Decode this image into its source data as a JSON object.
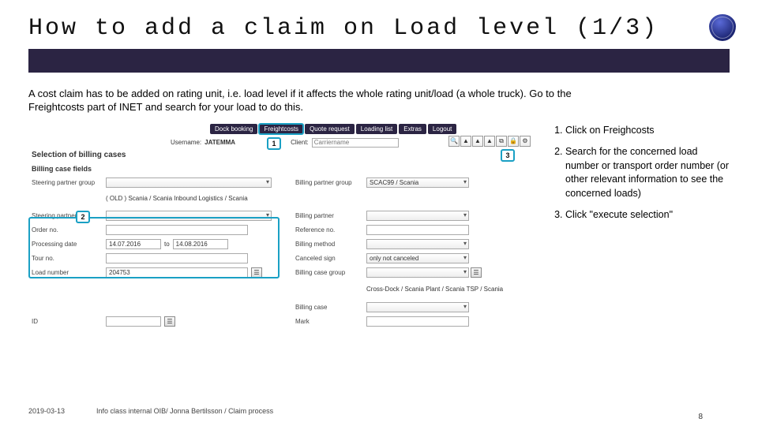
{
  "title": "How to add a claim on Load level (1/3)",
  "intro": "A cost claim has to be added on rating unit, i.e. load level if it affects the whole rating unit/load (a whole truck). Go to the Freightcosts part of INET and search for your load to do this.",
  "nav": {
    "tabs": [
      "Dock booking",
      "Freightcosts",
      "Quote request",
      "Loading list",
      "Extras",
      "Logout"
    ],
    "active_index": 1
  },
  "userline": {
    "username_label": "Username:",
    "username_value": "JATEMMA",
    "client_label": "Client:",
    "client_placeholder": "Carriername"
  },
  "sections": {
    "selection_title": "Selection of billing cases",
    "fields_title": "Billing case fields"
  },
  "form": {
    "steering_partner_group_label": "Steering partner group",
    "steering_partner_group_value": "( OLD ) Scania / Scania Inbound Logistics / Scania",
    "billing_partner_group_label": "Billing partner group",
    "billing_partner_group_value": "SCAC99 / Scania",
    "steering_partner_label": "Steering partner",
    "billing_partner_label": "Billing partner",
    "order_no_label": "Order no.",
    "reference_no_label": "Reference no.",
    "processing_date_label": "Processing date",
    "processing_date_from": "14.07.2016",
    "processing_date_to_label": "to",
    "processing_date_to": "14.08.2016",
    "billing_method_label": "Billing method",
    "tour_no_label": "Tour no.",
    "canceled_sign_label": "Canceled sign",
    "canceled_sign_value": "only not canceled",
    "load_number_label": "Load number",
    "load_number_value": "204753",
    "billing_case_group_label": "Billing case group",
    "billing_case_group_value": "Cross-Dock / Scania Plant / Scania TSP / Scania",
    "billing_case_label": "Billing case",
    "mark_label": "Mark",
    "id_label": "ID"
  },
  "callouts": {
    "c1": "1",
    "c2": "2",
    "c3": "3"
  },
  "instructions": {
    "i1": "Click on Freighcosts",
    "i2": "Search for the concerned load number or transport order number (or other relevant information to see the concerned loads)",
    "i3": "Click \"execute selection\""
  },
  "footer": {
    "date": "2019-03-13",
    "info": "Info class internal OIB/ Jonna Bertilsson / Claim process"
  },
  "pagenum": "8"
}
